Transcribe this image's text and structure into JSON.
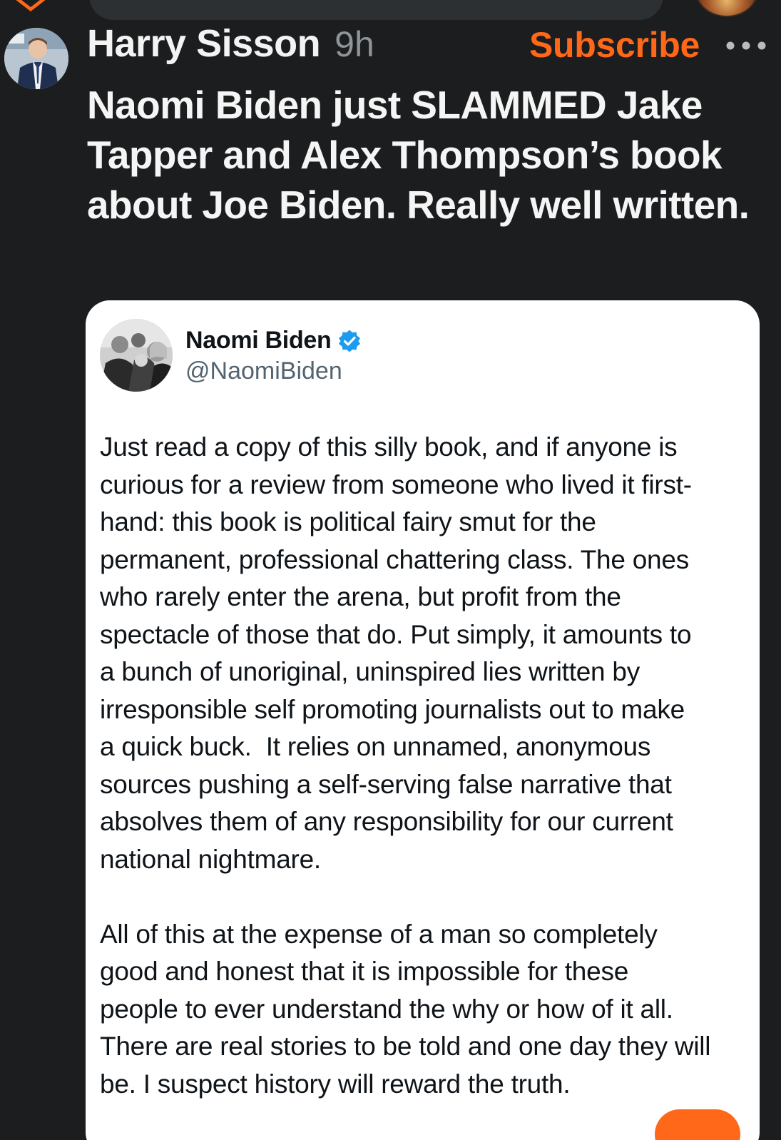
{
  "colors": {
    "background": "#1b1d1e",
    "accent": "#ff6719",
    "card": "#ffffff",
    "verified": "#1d9bf0"
  },
  "post": {
    "author_name": "Harry Sisson",
    "time": "9h",
    "subscribe_label": "Subscribe",
    "text": "Naomi Biden just SLAMMED Jake Tapper and Alex Thompson’s book about Joe Biden. Really well written."
  },
  "quote": {
    "name": "Naomi Biden",
    "handle": "@NaomiBiden",
    "body": "Just read a copy of this silly book, and if anyone is\ncurious for a review from someone who lived it first-\nhand: this book is political fairy smut for the\npermanent, professional chattering class. The ones\nwho rarely enter the arena, but profit from the\nspectacle of those that do. Put simply, it amounts to\na bunch of unoriginal, uninspired lies written by\nirresponsible self promoting journalists out to make\na quick buck.  It relies on unnamed, anonymous\nsources pushing a self-serving false narrative that\nabsolves them of any responsibility for our current\nnational nightmare.\n\nAll of this at the expense of a man so completely\ngood and honest that it is impossible for these\npeople to ever understand the why or how of it all.\nThere are real stories to be told and one day they will\nbe. I suspect history will reward the truth."
  },
  "icons": {
    "app": "app-logo-icon",
    "more": "more-options-icon",
    "verified": "verified-badge-icon"
  }
}
